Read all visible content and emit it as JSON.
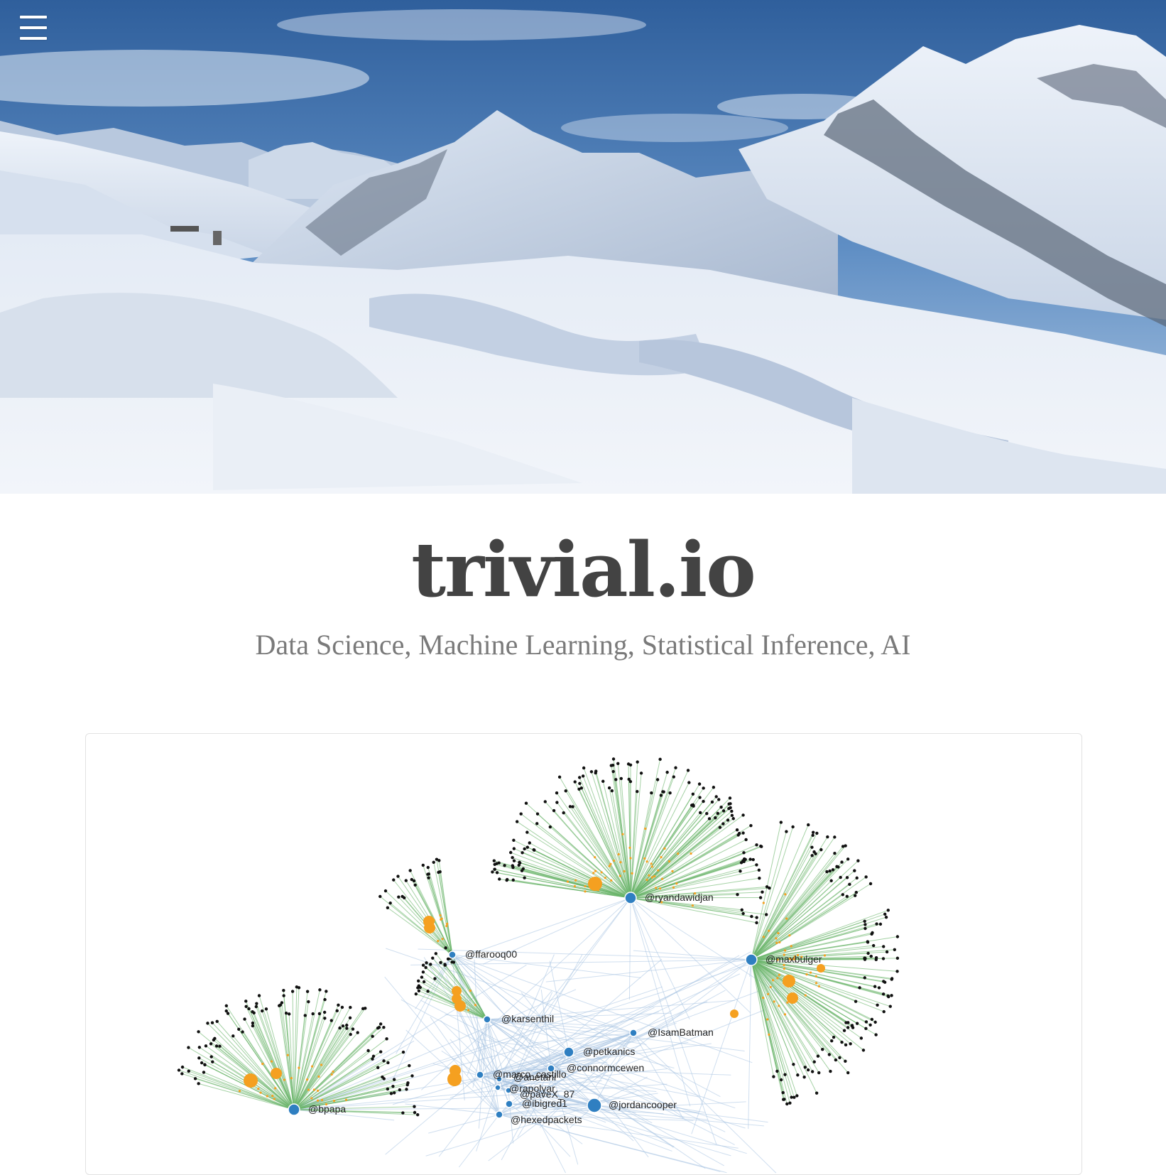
{
  "menu": {
    "icon": "hamburger-menu-icon"
  },
  "header": {
    "hero_image": "snowy mountain landscape"
  },
  "site": {
    "title": "trivial.io",
    "tagline": "Data Science, Machine Learning, Statistical Inference, AI"
  },
  "featured_post": {
    "graph_labels": {
      "ryandawidjan": "@ryandawidjan",
      "maxbulger": "@maxbulger",
      "ffarooq00": "@ffarooq00",
      "karsenthil": "@karsenthil",
      "IsamBatman": "@IsamBatman",
      "petkanics": "@petkanics",
      "connormcewen": "@connormcewen",
      "marco_castillo": "@marco_castillo",
      "anetani": "@anetani",
      "rapolyar": "@rapolyar",
      "paveX_87": "@paveX_87",
      "ibigred1": "@ibigred1",
      "jordancooper": "@jordancooper",
      "hexedpackets": "@hexedpackets",
      "bpapa": "@bpapa"
    },
    "colors": {
      "hub": "#2f7fc1",
      "follower": "#f5a020",
      "edge_green": "#6bb56b",
      "edge_blue": "#a8c4e2",
      "leaf": "#111111"
    }
  }
}
